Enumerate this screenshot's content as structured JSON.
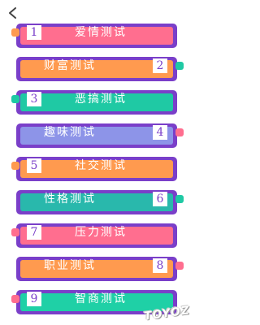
{
  "watermark": "TOYOZ",
  "colors": {
    "frame": "#7a3fc9",
    "pink": "#ff6e8f",
    "orange": "#ff9a4f",
    "teal": "#1fc9a4",
    "blue": "#8d94e8",
    "bgteal": "#29b8ac",
    "green": "#1fd0a6"
  },
  "items": [
    {
      "title": "爱情测试",
      "number": "1",
      "badge_side": "left",
      "bar_color": "#ff6e8f",
      "notch_color": "#ff9a4f"
    },
    {
      "title": "财富测试",
      "number": "2",
      "badge_side": "right",
      "bar_color": "#ff9a4f",
      "notch_color": "#1fc9a4"
    },
    {
      "title": "恶搞测试",
      "number": "3",
      "badge_side": "left",
      "bar_color": "#1fc9a4",
      "notch_color": "#1fc9a4"
    },
    {
      "title": "趣味测试",
      "number": "4",
      "badge_side": "right",
      "bar_color": "#8d94e8",
      "notch_color": "#ff6e8f"
    },
    {
      "title": "社交测试",
      "number": "5",
      "badge_side": "left",
      "bar_color": "#ff9a4f",
      "notch_color": "#ff9a4f"
    },
    {
      "title": "性格测试",
      "number": "6",
      "badge_side": "right",
      "bar_color": "#29b8ac",
      "notch_color": "#1fc9a4"
    },
    {
      "title": "压力测试",
      "number": "7",
      "badge_side": "left",
      "bar_color": "#ff6e8f",
      "notch_color": "#ff6e8f"
    },
    {
      "title": "职业测试",
      "number": "8",
      "badge_side": "right",
      "bar_color": "#ff9a4f",
      "notch_color": "#ff6e8f"
    },
    {
      "title": "智商测试",
      "number": "9",
      "badge_side": "left",
      "bar_color": "#1fd0a6",
      "notch_color": "#ff6e8f"
    }
  ]
}
